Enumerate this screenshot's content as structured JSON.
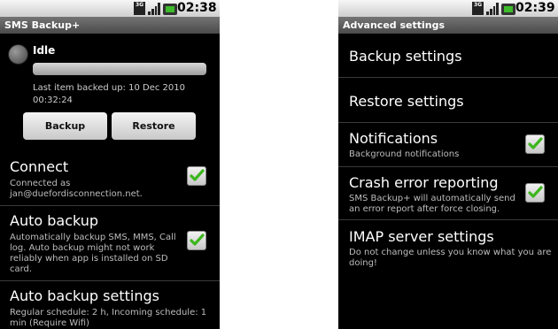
{
  "left_screen": {
    "status_bar": {
      "time": "02:38",
      "network_label": "3G"
    },
    "title": "SMS Backup+",
    "backup_status": "Idle",
    "progress": 0,
    "last_item": "Last item backed up: 10 Dec 2010 00:32:24",
    "buttons": {
      "backup": "Backup",
      "restore": "Restore"
    },
    "preferences": [
      {
        "title": "Connect",
        "summary": "Connected as jan@duefordisconnection.net.",
        "checked": true
      },
      {
        "title": "Auto backup",
        "summary": "Automatically backup SMS, MMS, Call log. Auto backup might not work reliably when app is installed on SD card.",
        "checked": true
      },
      {
        "title": "Auto backup settings",
        "summary": "Regular schedule: 2 h, Incoming schedule: 1 min (Require Wifi)"
      }
    ]
  },
  "right_screen": {
    "status_bar": {
      "time": "02:39",
      "network_label": "3G"
    },
    "title": "Advanced settings",
    "items": [
      {
        "title": "Backup settings"
      },
      {
        "title": "Restore settings"
      },
      {
        "title": "Notifications",
        "summary": "Background notifications",
        "checked": true
      },
      {
        "title": "Crash error reporting",
        "summary": "SMS Backup+ will automatically send an error report after force closing.",
        "checked": true
      },
      {
        "title": "IMAP server settings",
        "summary": "Do not change unless you know what you are doing!"
      }
    ]
  },
  "colors": {
    "check_green": "#3cb61e",
    "title_bar": "#5a5a5a",
    "background": "#000000"
  }
}
